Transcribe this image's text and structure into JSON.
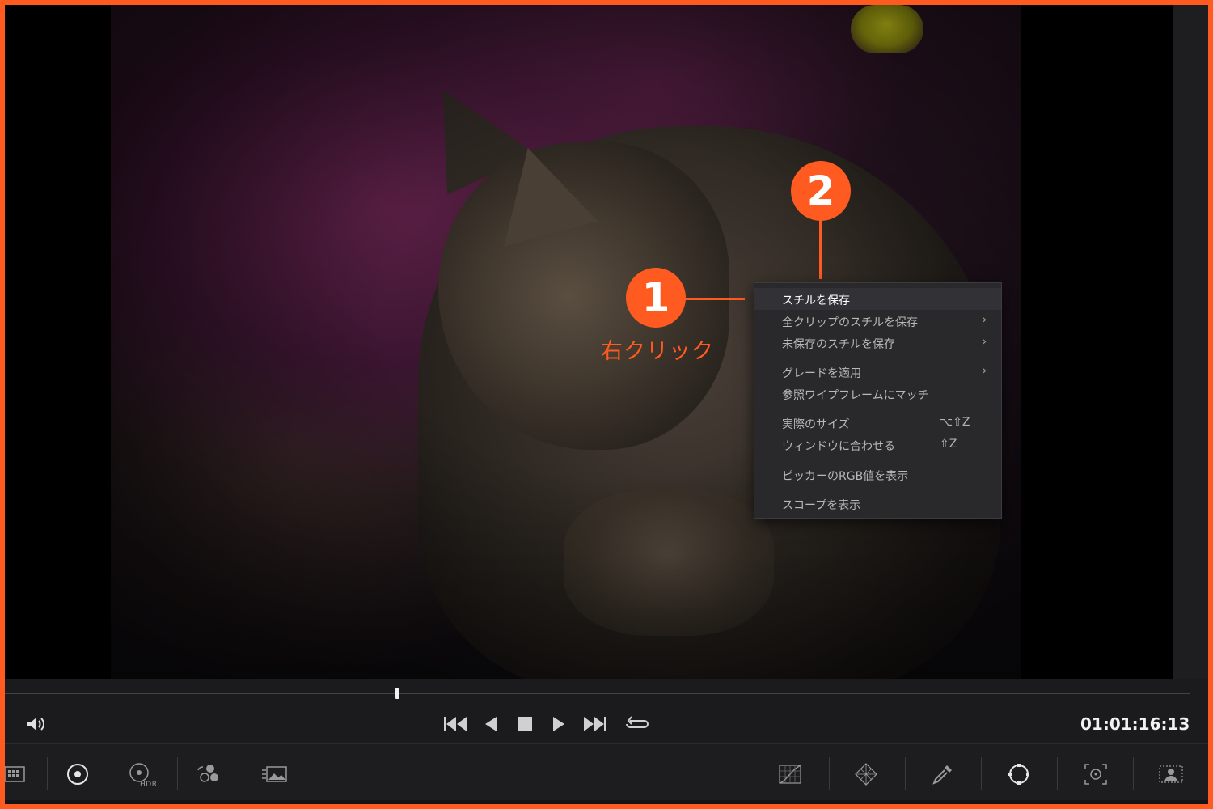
{
  "annotations": {
    "badge1": "1",
    "badge2": "2",
    "callout": "右クリック",
    "accent_color": "#ff5a1f"
  },
  "context_menu": {
    "items": [
      {
        "label": "スチルを保存",
        "shortcut": "",
        "submenu": false,
        "active": true
      },
      {
        "label": "全クリップのスチルを保存",
        "shortcut": "",
        "submenu": true,
        "active": false
      },
      {
        "label": "未保存のスチルを保存",
        "shortcut": "",
        "submenu": true,
        "active": false
      },
      {
        "label": "グレードを適用",
        "shortcut": "",
        "submenu": true,
        "active": false
      },
      {
        "label": "参照ワイプフレームにマッチ",
        "shortcut": "",
        "submenu": false,
        "active": false
      },
      {
        "label": "実際のサイズ",
        "shortcut": "⌥⇧Z",
        "submenu": false,
        "active": false
      },
      {
        "label": "ウィンドウに合わせる",
        "shortcut": "⇧Z",
        "submenu": false,
        "active": false
      },
      {
        "label": "ピッカーのRGB値を表示",
        "shortcut": "",
        "submenu": false,
        "active": false
      },
      {
        "label": "スコープを表示",
        "shortcut": "",
        "submenu": false,
        "active": false
      }
    ],
    "chevron": "›"
  },
  "transport": {
    "timecode": "01:01:16:13",
    "icons": [
      "volume-icon",
      "skip-to-start-icon",
      "play-reverse-icon",
      "stop-icon",
      "play-icon",
      "skip-to-end-icon",
      "loop-icon"
    ]
  },
  "toolbar": {
    "hdr_label": "HDR",
    "left_tools": [
      "clip-grid-icon",
      "primaries-wheels-icon",
      "hdr-wheels-icon",
      "rgb-mixer-icon",
      "motion-effects-icon"
    ],
    "right_tools": [
      "curves-icon",
      "color-warper-icon",
      "qualifier-picker-icon",
      "power-window-icon",
      "tracker-icon",
      "magic-mask-icon"
    ],
    "active_tools": [
      "primaries-wheels-icon",
      "power-window-icon"
    ]
  }
}
